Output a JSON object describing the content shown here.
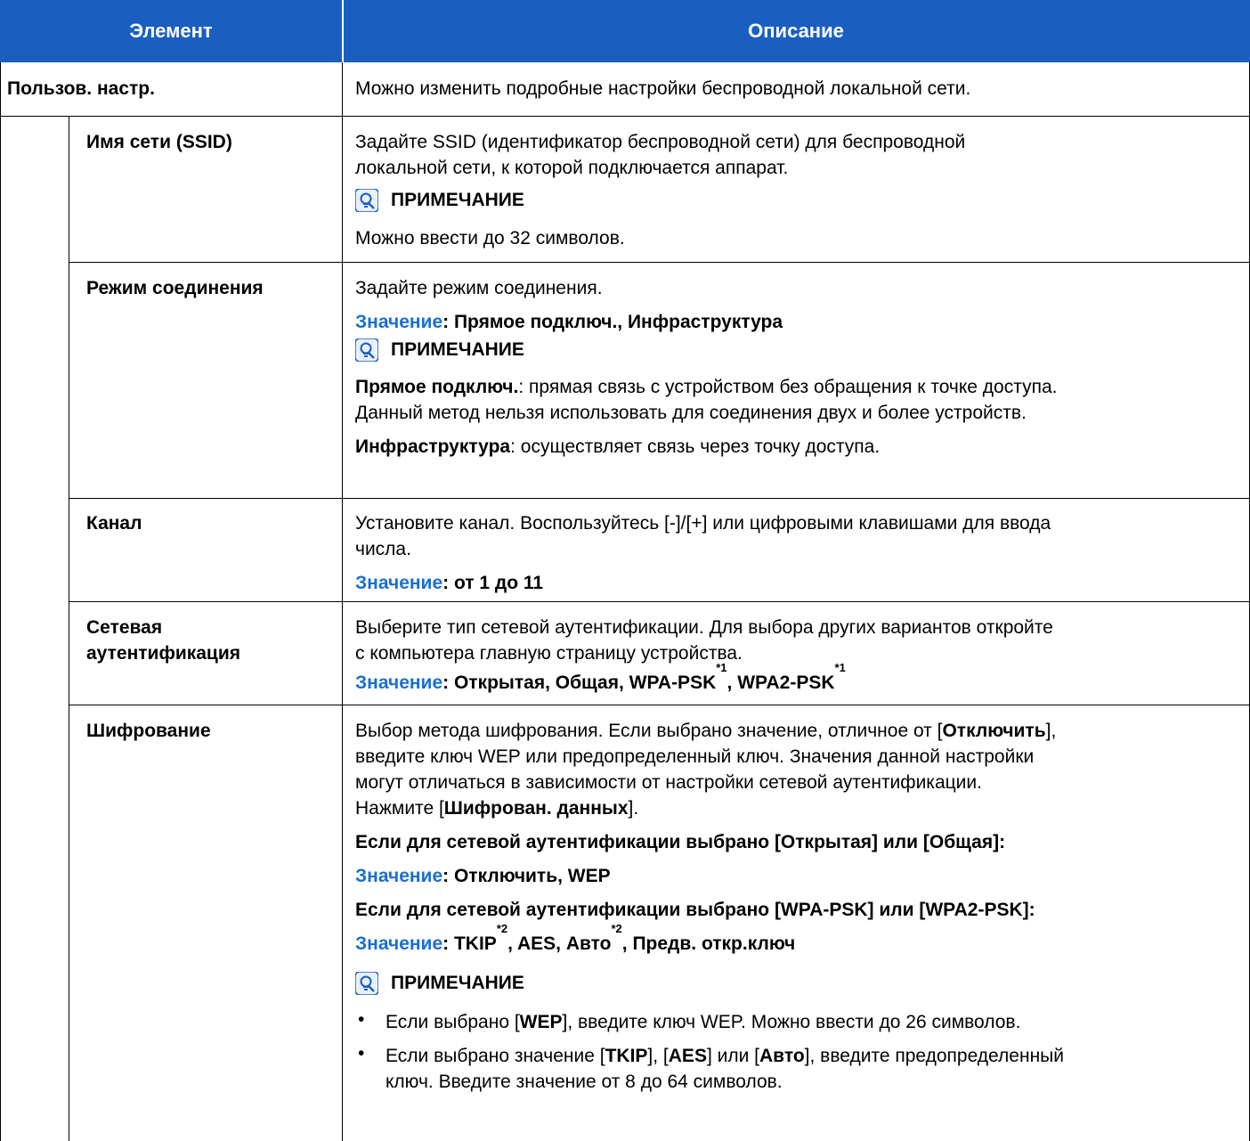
{
  "header": {
    "col1": "Элемент",
    "col2": "Описание"
  },
  "colors": {
    "header_bg": "#1a5fc0",
    "accent": "#1a6fd0"
  },
  "note_icon": "note-lightbulb-icon",
  "note_label": "ПРИМЕЧАНИЕ",
  "value_label": "Значение",
  "rows": {
    "user_settings": {
      "label": "Пользов. настр.",
      "desc": "Можно изменить подробные настройки беспроводной локальной сети."
    },
    "ssid": {
      "label": "Имя сети (SSID)",
      "desc1": "Задайте SSID (идентификатор беспроводной сети) для беспроводной",
      "desc2": "локальной сети, к которой подключается аппарат.",
      "note": "Можно ввести до 32 символов."
    },
    "conn_mode": {
      "label": "Режим соединения",
      "desc": "Задайте режим соединения.",
      "value": ": Прямое подключ., Инфраструктура",
      "note1_bold": "Прямое подключ.",
      "note1_rest": ": прямая связь с устройством без обращения к точке доступа.",
      "note2": "Данный метод нельзя использовать для соединения двух и более устройств.",
      "note3_bold": "Инфраструктура",
      "note3_rest": ": осуществляет связь через точку доступа."
    },
    "channel": {
      "label": "Канал",
      "desc1": "Установите канал. Воспользуйтесь [-]/[+] или цифровыми клавишами для ввода",
      "desc2": "числа.",
      "value": ": от 1 до 11"
    },
    "net_auth": {
      "label1": "Сетевая",
      "label2": "аутентификация",
      "desc1": "Выберите тип сетевой аутентификации. Для выбора других вариантов откройте",
      "desc2": "с компьютера главную страницу устройства.",
      "value_a": ": Открытая, Общая, WPA-PSK",
      "sup1": "*1",
      "value_b": ", WPA2-PSK",
      "sup2": "*1"
    },
    "encryption": {
      "label": "Шифрование",
      "d1a": "Выбор метода шифрования. Если выбрано значение, отличное от [",
      "d1b": "Отключить",
      "d1c": "],",
      "d2": "введите ключ WEP или предопределенный ключ. Значения данной настройки",
      "d3": "могут отличаться в зависимости от настройки сетевой аутентификации.",
      "d4a": "Нажмите [",
      "d4b": "Шифрован. данных",
      "d4c": "].",
      "cond1": "Если для сетевой аутентификации выбрано [Открытая] или [Общая]:",
      "val1": ": Отключить, WEP",
      "cond2": "Если для сетевой аутентификации выбрано [WPA-PSK] или [WPA2-PSK]:",
      "val2a": ": TKIP",
      "val2s1": "*2",
      "val2b": ", AES, Авто",
      "val2s2": "*2",
      "val2c": ", Предв. откр.ключ",
      "bullet": "•",
      "b1a": "Если выбрано [",
      "b1b": "WEP",
      "b1c": "], введите ключ WEP. Можно ввести до 26 символов.",
      "b2a": "Если выбрано значение [",
      "b2b": "TKIP",
      "b2c": "], [",
      "b2d": "AES",
      "b2e": "] или [",
      "b2f": "Авто",
      "b2g": "], введите предопределенный",
      "b2h": "ключ. Введите значение от 8 до 64 символов."
    }
  }
}
